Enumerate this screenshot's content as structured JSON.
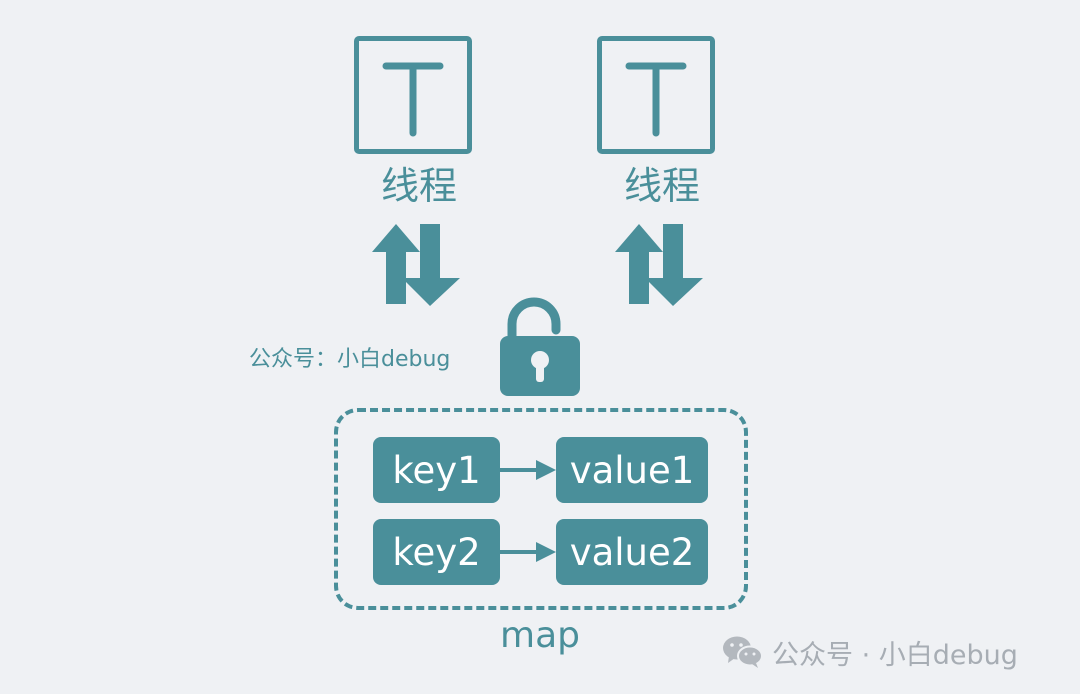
{
  "threads": [
    {
      "icon_letter": "T",
      "label": "线程"
    },
    {
      "icon_letter": "T",
      "label": "线程"
    }
  ],
  "watermark_left": "公众号：小白debug",
  "map": {
    "label": "map",
    "entries": [
      {
        "key": "key1",
        "value": "value1"
      },
      {
        "key": "key2",
        "value": "value2"
      }
    ]
  },
  "footer_watermark": {
    "icon": "wechat-icon",
    "text": "公众号 · 小白debug"
  },
  "colors": {
    "accent": "#4a8f9a",
    "background": "#eff1f4",
    "watermark": "#a7adb4"
  }
}
